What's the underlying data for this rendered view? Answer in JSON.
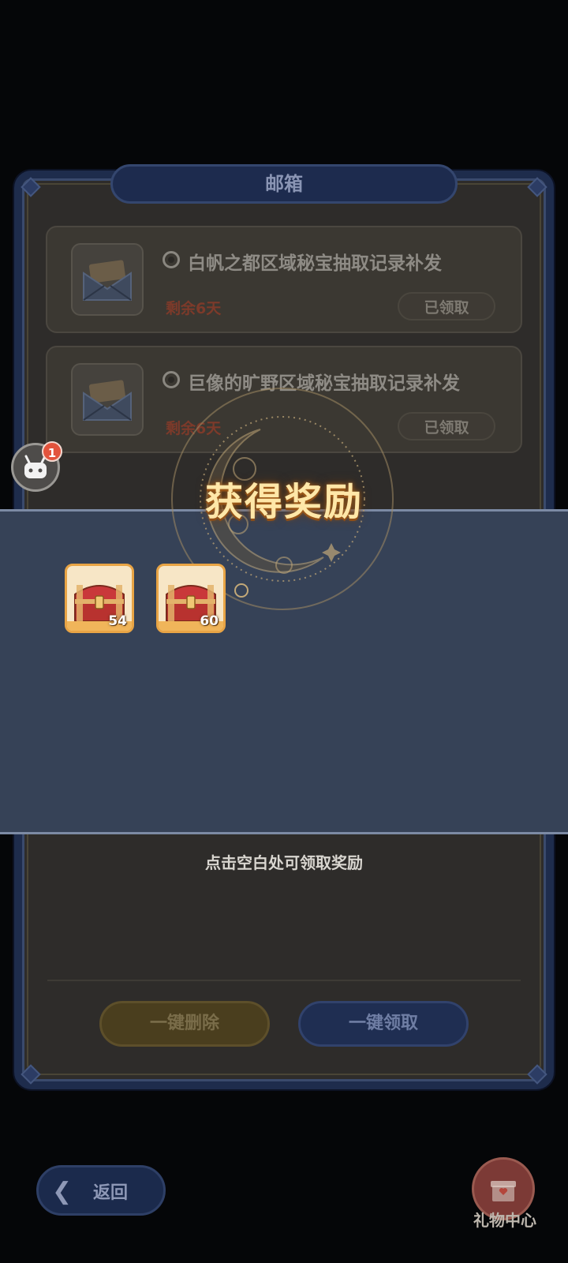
{
  "mailbox": {
    "title": "邮箱",
    "mails": [
      {
        "title": "白帆之都区域秘宝抽取记录补发",
        "remaining": "剩余6天",
        "status_label": "已领取"
      },
      {
        "title": "巨像的旷野区域秘宝抽取记录补发",
        "remaining": "剩余6天",
        "status_label": "已领取"
      }
    ],
    "delete_all_label": "一键删除",
    "claim_all_label": "一键领取"
  },
  "floating": {
    "assistant_badge_count": "1"
  },
  "reward": {
    "title": "获得奖励",
    "items": [
      {
        "icon": "treasure-chest-icon",
        "quantity": "54"
      },
      {
        "icon": "treasure-chest-icon",
        "quantity": "60"
      }
    ],
    "hint": "点击空白处可领取奖励"
  },
  "nav": {
    "back_label": "返回",
    "gift_center_label": "礼物中心"
  },
  "colors": {
    "overlay_band": "#364257",
    "reward_title": "#ffe7a8",
    "item_border": "#e8a445",
    "badge": "#e2533c"
  }
}
